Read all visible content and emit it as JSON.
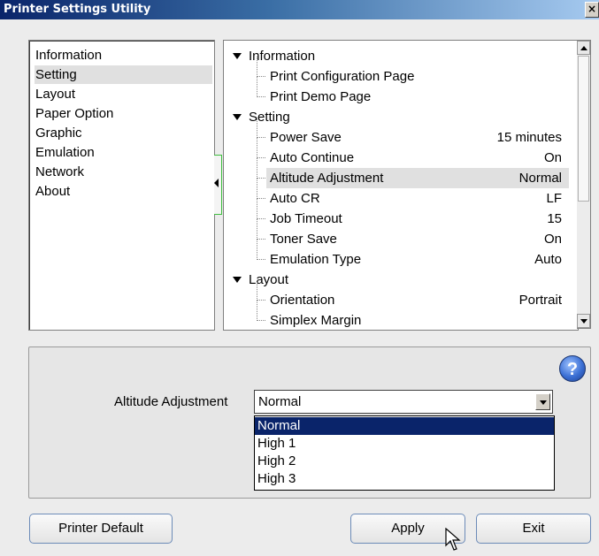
{
  "window": {
    "title": "Printer Settings Utility",
    "close_glyph": "×"
  },
  "sidebar": {
    "items": [
      {
        "label": "Information"
      },
      {
        "label": "Setting",
        "selected": true
      },
      {
        "label": "Layout"
      },
      {
        "label": "Paper Option"
      },
      {
        "label": "Graphic"
      },
      {
        "label": "Emulation"
      },
      {
        "label": "Network"
      },
      {
        "label": "About"
      }
    ]
  },
  "tree": {
    "rows": [
      {
        "type": "group",
        "label": "Information"
      },
      {
        "type": "item",
        "label": "Print Configuration Page",
        "value": ""
      },
      {
        "type": "item",
        "label": "Print Demo Page",
        "value": ""
      },
      {
        "type": "group",
        "label": "Setting"
      },
      {
        "type": "item",
        "label": "Power Save",
        "value": "15 minutes"
      },
      {
        "type": "item",
        "label": "Auto Continue",
        "value": "On"
      },
      {
        "type": "item",
        "label": "Altitude Adjustment",
        "value": "Normal",
        "selected": true
      },
      {
        "type": "item",
        "label": "Auto CR",
        "value": "LF"
      },
      {
        "type": "item",
        "label": "Job Timeout",
        "value": "15"
      },
      {
        "type": "item",
        "label": "Toner Save",
        "value": "On"
      },
      {
        "type": "item",
        "label": "Emulation Type",
        "value": "Auto"
      },
      {
        "type": "group",
        "label": "Layout"
      },
      {
        "type": "item",
        "label": "Orientation",
        "value": "Portrait"
      },
      {
        "type": "item",
        "label": "Simplex Margin",
        "value": ""
      }
    ]
  },
  "settings": {
    "field_label": "Altitude Adjustment",
    "selected_value": "Normal",
    "help_glyph": "?",
    "options": [
      "Normal",
      "High 1",
      "High 2",
      "High 3"
    ]
  },
  "buttons": {
    "printer_default": "Printer Default",
    "apply": "Apply",
    "exit": "Exit"
  },
  "colors": {
    "titlebar": "#0a246a",
    "selection_highlight": "#0a246a",
    "list_selection": "#e0e0e0",
    "help_icon": "#3b6fd4"
  }
}
